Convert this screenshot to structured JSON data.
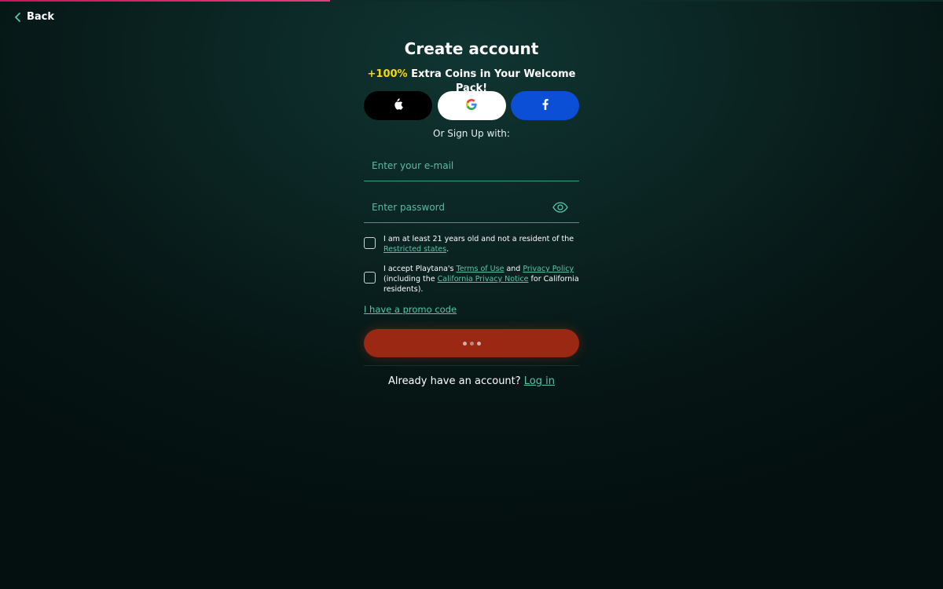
{
  "progress": {
    "fraction": 0.35,
    "color": "#c2185b"
  },
  "nav": {
    "back_label": "Back",
    "back_icon": "chevron-left-icon"
  },
  "form": {
    "title": "Create account",
    "promo_highlight": "+100%",
    "promo_text": " Extra Coins in Your Welcome Pack!",
    "social": [
      {
        "provider": "Apple",
        "icon": "apple-icon"
      },
      {
        "provider": "Google",
        "icon": "google-icon"
      },
      {
        "provider": "Facebook",
        "icon": "facebook-icon"
      }
    ],
    "or_text": "Or Sign Up with:",
    "email_placeholder": "Enter your e-mail",
    "email_value": "",
    "password_placeholder": "Enter password",
    "password_value": "",
    "age_check": {
      "text_before": "I am at least 21 years old and not a resident of the ",
      "link": "Restricted states",
      "text_after": ".",
      "checked": false
    },
    "terms_check": {
      "text_1": "I accept Playtana's ",
      "link_terms": "Terms of Use",
      "text_2": " and ",
      "link_privacy": "Privacy Policy",
      "text_3": " (including the ",
      "link_california": "California Privacy Notice",
      "text_4": " for California residents).",
      "checked": false
    },
    "promo_code_link": "I have a promo code",
    "submit_state": "loading",
    "login_prompt": "Already have an account? ",
    "login_link": "Log in"
  },
  "colors": {
    "accent": "#54c7a8",
    "highlight": "#f5d90a",
    "submit": "#9b2812",
    "facebook": "#0a4fd6"
  }
}
